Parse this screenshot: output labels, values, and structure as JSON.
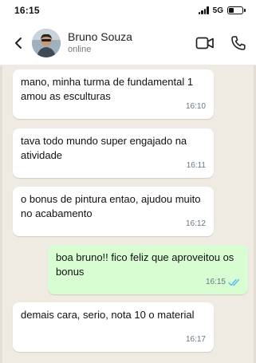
{
  "status_bar": {
    "time": "16:15",
    "network": "5G",
    "battery_level": 0.4
  },
  "header": {
    "back_icon": "chevron-left-icon",
    "contact_name": "Bruno Souza",
    "contact_status": "online",
    "actions": [
      "video-call-icon",
      "phone-icon"
    ]
  },
  "messages": [
    {
      "direction": "incoming",
      "text": "mano, minha turma de fundamental 1 amou as esculturas",
      "time": "16:10"
    },
    {
      "direction": "incoming",
      "text": "tava todo mundo super engajado na atividade",
      "time": "16:11"
    },
    {
      "direction": "incoming",
      "text": "o bonus de pintura entao, ajudou muito no acabamento",
      "time": "16:12"
    },
    {
      "direction": "outgoing",
      "text": "boa bruno!! fico feliz que aproveitou os bonus",
      "time": "16:15",
      "status": "read"
    },
    {
      "direction": "incoming",
      "text": "demais cara, serio, nota 10 o material",
      "time": "16:17"
    }
  ],
  "colors": {
    "chat_bg": "#efeae2",
    "incoming_bubble": "#ffffff",
    "outgoing_bubble": "#d9fdd3",
    "read_ticks": "#53bdeb"
  }
}
